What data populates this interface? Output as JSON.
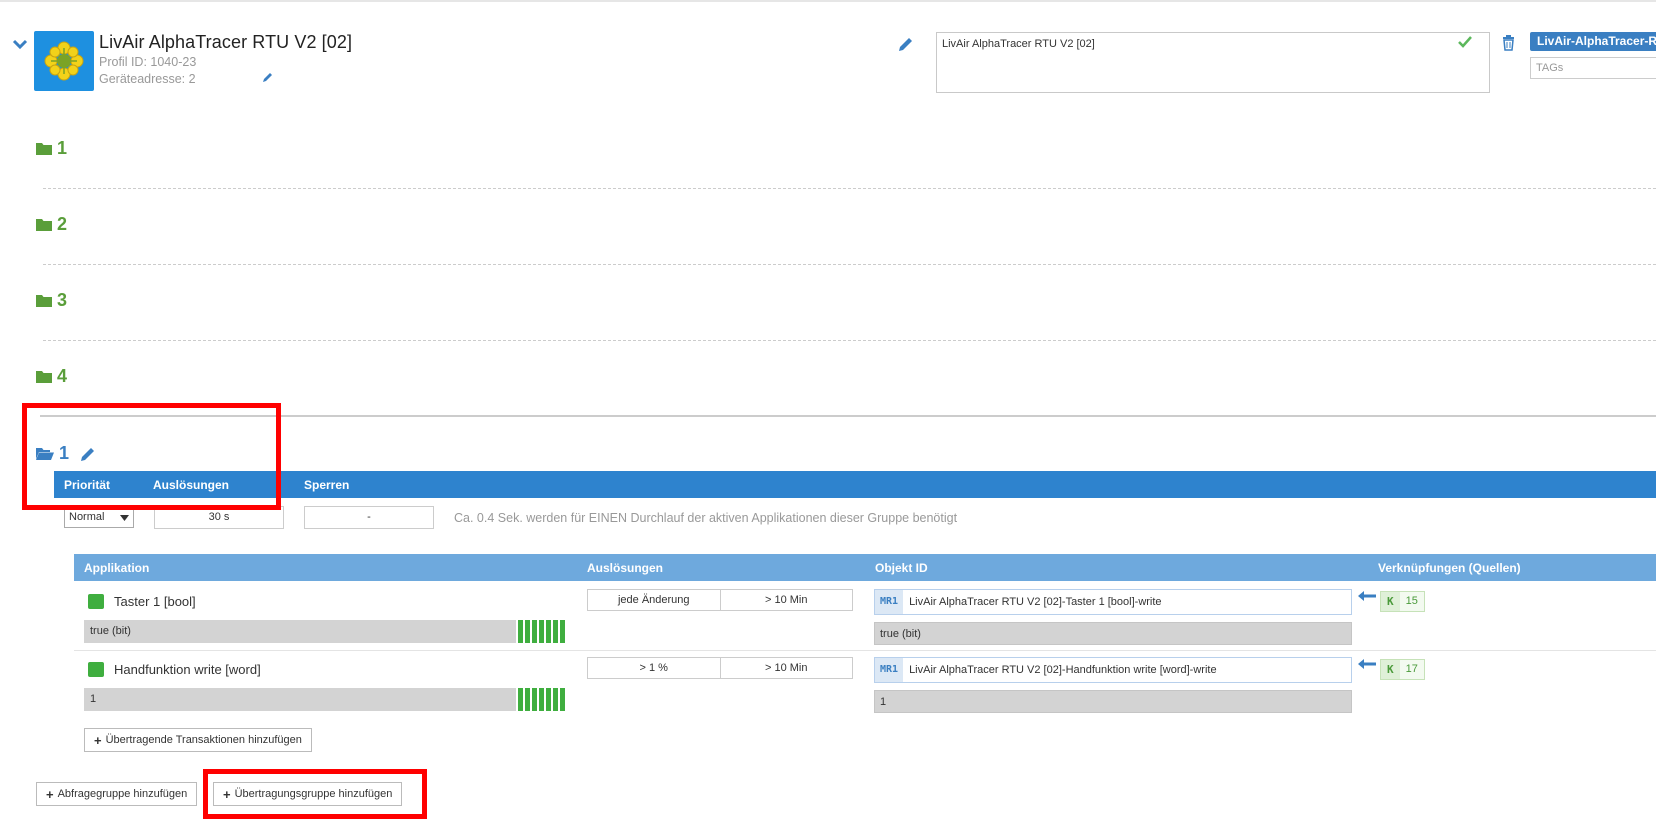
{
  "device": {
    "title": "LivAir AlphaTracer RTU V2 [02]",
    "profile_id": "Profil ID: 1040-23",
    "address": "Geräteadresse: 2",
    "description": "LivAir AlphaTracer RTU V2 [02]",
    "tag_badge": "LivAir-AlphaTracer-RT",
    "tags_placeholder": "TAGs"
  },
  "query_groups": [
    "1",
    "2",
    "3",
    "4"
  ],
  "transfer_group": {
    "name": "1",
    "headers": {
      "priority": "Priorität",
      "triggers": "Auslösungen",
      "locks": "Sperren"
    },
    "priority_value": "Normal",
    "trigger_value": "30 s",
    "lock_value": "-",
    "info": "Ca. 0.4 Sek. werden für EINEN Durchlauf der aktiven Applikationen dieser Gruppe benötigt"
  },
  "apps_table": {
    "headers": {
      "application": "Applikation",
      "triggers": "Auslösungen",
      "object_id": "Objekt ID",
      "links": "Verknüpfungen (Quellen)"
    },
    "rows": [
      {
        "name": "Taster 1 [bool]",
        "value": "true (bit)",
        "trigger_left": "jede Änderung",
        "trigger_right": "> 10 Min",
        "mr": "MR1",
        "object": "LivAir AlphaTracer RTU V2 [02]-Taster 1 [bool]-write",
        "object_value": "true (bit)",
        "k": "K",
        "link_count": "15"
      },
      {
        "name": "Handfunktion write [word]",
        "value": "1",
        "trigger_left": "> 1 %",
        "trigger_right": "> 10 Min",
        "mr": "MR1",
        "object": "LivAir AlphaTracer RTU V2 [02]-Handfunktion write [word]-write",
        "object_value": "1",
        "k": "K",
        "link_count": "17"
      }
    ]
  },
  "buttons": {
    "add_transactions": "Übertragende Transaktionen hinzufügen",
    "add_query_group": "Abfragegruppe hinzufügen",
    "add_transfer_group": "Übertragungsgruppe hinzufügen"
  },
  "colors": {
    "header_blue": "#2e83ce",
    "subheader_blue": "#6ea9dd",
    "folder_green": "#5a9e3a",
    "status_green": "#3fae3f",
    "highlight_red": "#ff0000"
  }
}
